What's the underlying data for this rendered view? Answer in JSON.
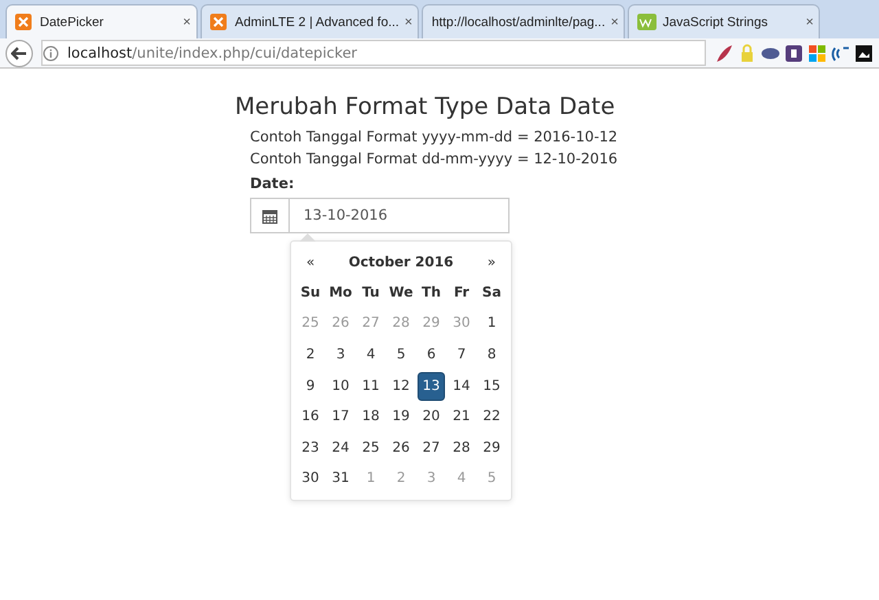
{
  "browser": {
    "tabs": [
      {
        "label": "DatePicker",
        "selected": true,
        "kind": "xampp",
        "close": "×"
      },
      {
        "label": "AdminLTE 2 | Advanced fo...",
        "selected": false,
        "kind": "xampp",
        "close": "×"
      },
      {
        "label": "http://localhost/adminlte/pag...",
        "selected": false,
        "kind": "plain",
        "close": "×"
      },
      {
        "label": "JavaScript Strings",
        "selected": false,
        "kind": "w3",
        "close": "×"
      }
    ],
    "address": {
      "host": "localhost",
      "path": "/unite/index.php/cui/datepicker"
    }
  },
  "page": {
    "title": "Merubah Format Type Data Date",
    "examples": [
      "Contoh Tanggal Format yyyy-mm-dd = 2016-10-12",
      "Contoh Tanggal Format dd-mm-yyyy = 12-10-2016"
    ],
    "field_label": "Date:",
    "field_value": "13-10-2016"
  },
  "datepicker": {
    "prev": "«",
    "month": "October 2016",
    "next": "»",
    "weekdays": [
      "Su",
      "Mo",
      "Tu",
      "We",
      "Th",
      "Fr",
      "Sa"
    ],
    "days": [
      {
        "label": "25",
        "muted": true,
        "selected": false
      },
      {
        "label": "26",
        "muted": true,
        "selected": false
      },
      {
        "label": "27",
        "muted": true,
        "selected": false
      },
      {
        "label": "28",
        "muted": true,
        "selected": false
      },
      {
        "label": "29",
        "muted": true,
        "selected": false
      },
      {
        "label": "30",
        "muted": true,
        "selected": false
      },
      {
        "label": "1",
        "muted": false,
        "selected": false
      },
      {
        "label": "2",
        "muted": false,
        "selected": false
      },
      {
        "label": "3",
        "muted": false,
        "selected": false
      },
      {
        "label": "4",
        "muted": false,
        "selected": false
      },
      {
        "label": "5",
        "muted": false,
        "selected": false
      },
      {
        "label": "6",
        "muted": false,
        "selected": false
      },
      {
        "label": "7",
        "muted": false,
        "selected": false
      },
      {
        "label": "8",
        "muted": false,
        "selected": false
      },
      {
        "label": "9",
        "muted": false,
        "selected": false
      },
      {
        "label": "10",
        "muted": false,
        "selected": false
      },
      {
        "label": "11",
        "muted": false,
        "selected": false
      },
      {
        "label": "12",
        "muted": false,
        "selected": false
      },
      {
        "label": "13",
        "muted": false,
        "selected": true
      },
      {
        "label": "14",
        "muted": false,
        "selected": false
      },
      {
        "label": "15",
        "muted": false,
        "selected": false
      },
      {
        "label": "16",
        "muted": false,
        "selected": false
      },
      {
        "label": "17",
        "muted": false,
        "selected": false
      },
      {
        "label": "18",
        "muted": false,
        "selected": false
      },
      {
        "label": "19",
        "muted": false,
        "selected": false
      },
      {
        "label": "20",
        "muted": false,
        "selected": false
      },
      {
        "label": "21",
        "muted": false,
        "selected": false
      },
      {
        "label": "22",
        "muted": false,
        "selected": false
      },
      {
        "label": "23",
        "muted": false,
        "selected": false
      },
      {
        "label": "24",
        "muted": false,
        "selected": false
      },
      {
        "label": "25",
        "muted": false,
        "selected": false
      },
      {
        "label": "26",
        "muted": false,
        "selected": false
      },
      {
        "label": "27",
        "muted": false,
        "selected": false
      },
      {
        "label": "28",
        "muted": false,
        "selected": false
      },
      {
        "label": "29",
        "muted": false,
        "selected": false
      },
      {
        "label": "30",
        "muted": false,
        "selected": false
      },
      {
        "label": "31",
        "muted": false,
        "selected": false
      },
      {
        "label": "1",
        "muted": true,
        "selected": false
      },
      {
        "label": "2",
        "muted": true,
        "selected": false
      },
      {
        "label": "3",
        "muted": true,
        "selected": false
      },
      {
        "label": "4",
        "muted": true,
        "selected": false
      },
      {
        "label": "5",
        "muted": true,
        "selected": false
      }
    ]
  }
}
